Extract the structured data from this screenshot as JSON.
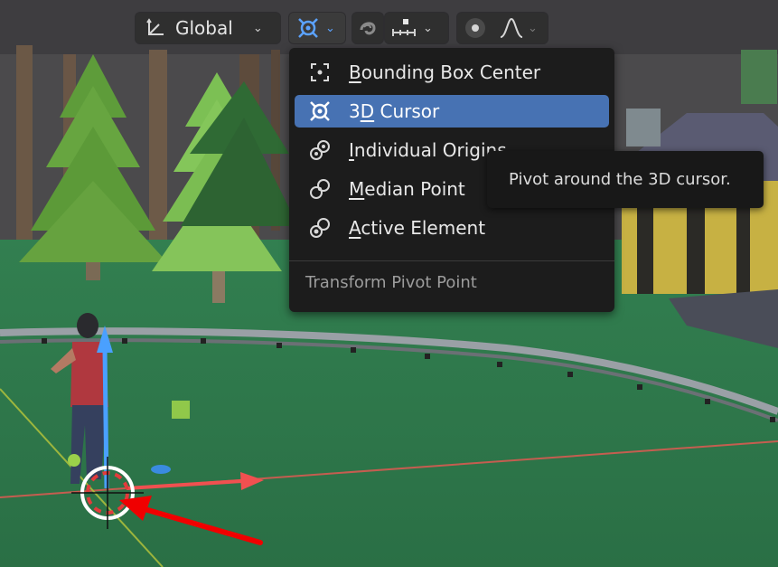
{
  "header": {
    "orientation": {
      "label": "Global",
      "icon": "transform-orientation-icon"
    },
    "pivot": {
      "icon": "3d-cursor-icon"
    },
    "snapping": {
      "magnet_icon": "snap-magnet-icon",
      "snap_target_icon": "snap-increment-icon"
    },
    "proportional": {
      "icon": "proportional-edit-icon",
      "falloff_icon": "falloff-curve-icon"
    }
  },
  "pivot_menu": {
    "items": [
      {
        "label": "Bounding Box Center",
        "underline": "B",
        "rest": "ounding Box Center",
        "icon": "bounding-box-center-icon",
        "selected": false
      },
      {
        "label": "3D Cursor",
        "underline": "D",
        "prefix": "3",
        "rest": " Cursor",
        "icon": "3d-cursor-icon",
        "selected": true
      },
      {
        "label": "Individual Origins",
        "underline": "I",
        "rest": "ndividual Origins",
        "icon": "individual-origins-icon",
        "selected": false
      },
      {
        "label": "Median Point",
        "underline": "M",
        "rest": "edian Point",
        "icon": "median-point-icon",
        "selected": false
      },
      {
        "label": "Active Element",
        "underline": "A",
        "rest": "ctive Element",
        "icon": "active-element-icon",
        "selected": false
      }
    ],
    "title": "Transform Pivot Point"
  },
  "tooltip": {
    "text": "Pivot around the 3D cursor."
  },
  "colors": {
    "menu_bg": "#1c1c1c",
    "selection": "#4772b3",
    "header_bg": "#2f2f2f",
    "ground": "#2d7a4a",
    "x_axis": "#e04848",
    "z_axis": "#4aa0ff",
    "annotation_arrow": "#f00000"
  }
}
